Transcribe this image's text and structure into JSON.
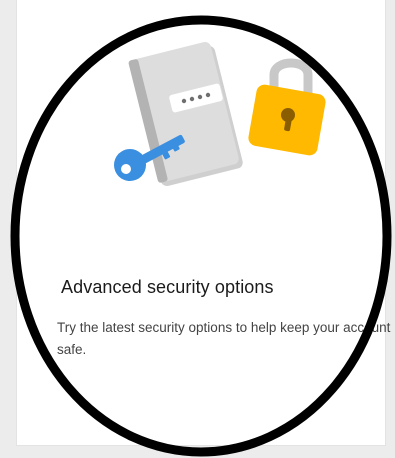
{
  "card": {
    "title": "Advanced security options",
    "description": "Try the latest security options to help keep your account safe.",
    "illustration_icons": [
      "password-book-icon",
      "key-icon",
      "padlock-icon"
    ]
  },
  "colors": {
    "book": "#d7d7d7",
    "book_spine": "#b3b3b3",
    "key": "#3a8fe0",
    "padlock_body": "#ffb900",
    "padlock_shackle": "#c8c8c8",
    "ring": "#000000"
  }
}
